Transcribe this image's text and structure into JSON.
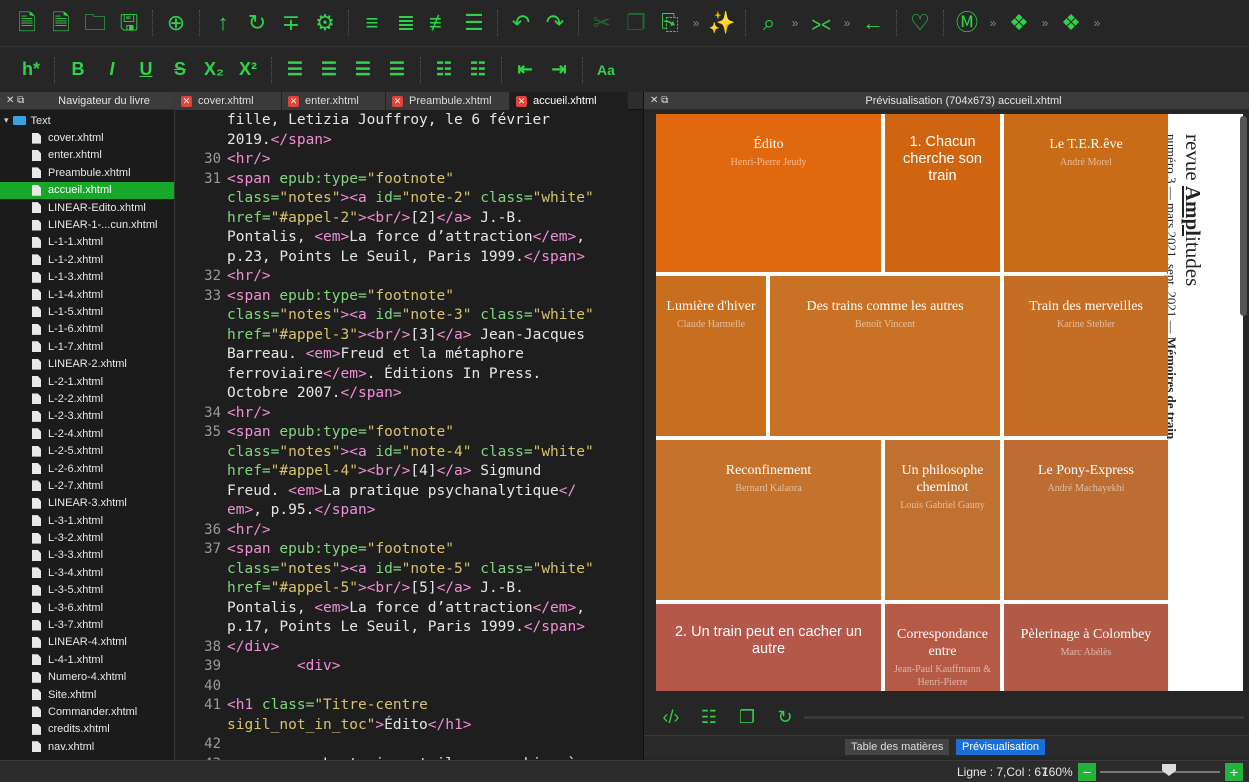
{
  "toolbar_icons": [
    "new-html-file-icon",
    "new-css-file-icon",
    "open-folder-icon",
    "save-icon",
    "add-existing-icon",
    "go-up-icon",
    "reload-icon",
    "text-direction-icon",
    "settings-icon",
    "tag-check-icon",
    "tag-add-icon",
    "tag-remove-icon",
    "tag-merge-icon",
    "undo-icon",
    "redo-icon",
    "cut-icon",
    "copy-icon",
    "paste-icon",
    "magic-wand-icon",
    "search-icon",
    "split-icon",
    "back-icon",
    "heart-icon",
    "metadata-icon",
    "plugin-icon",
    "plugin-2-icon"
  ],
  "format_toolbar": {
    "heading": "h*",
    "bold": "B",
    "italic": "I",
    "underline": "U",
    "strike": "S",
    "subscript": "X₂",
    "superscript": "X²",
    "case": "Aa"
  },
  "book_browser": {
    "title": "Navigateur du livre",
    "folder": "Text",
    "files": [
      "cover.xhtml",
      "enter.xhtml",
      "Preambule.xhtml",
      "accueil.xhtml",
      "LINEAR-Edito.xhtml",
      "LINEAR-1-...cun.xhtml",
      "L-1-1.xhtml",
      "L-1-2.xhtml",
      "L-1-3.xhtml",
      "L-1-4.xhtml",
      "L-1-5.xhtml",
      "L-1-6.xhtml",
      "L-1-7.xhtml",
      "LINEAR-2.xhtml",
      "L-2-1.xhtml",
      "L-2-2.xhtml",
      "L-2-3.xhtml",
      "L-2-4.xhtml",
      "L-2-5.xhtml",
      "L-2-6.xhtml",
      "L-2-7.xhtml",
      "LINEAR-3.xhtml",
      "L-3-1.xhtml",
      "L-3-2.xhtml",
      "L-3-3.xhtml",
      "L-3-4.xhtml",
      "L-3-5.xhtml",
      "L-3-6.xhtml",
      "L-3-7.xhtml",
      "LINEAR-4.xhtml",
      "L-4-1.xhtml",
      "Numero-4.xhtml",
      "Site.xhtml",
      "Commander.xhtml",
      "credits.xhtml",
      "nav.xhtml"
    ],
    "selected": "accueil.xhtml"
  },
  "tabs": [
    "cover.xhtml",
    "enter.xhtml",
    "Preambule.xhtml",
    "accueil.xhtml"
  ],
  "active_tab": "accueil.xhtml",
  "code_lines": [
    {
      "n": "",
      "parts": [
        [
          "tx",
          "fille, Letizia Jouffroy, le 6 février"
        ]
      ]
    },
    {
      "n": "",
      "parts": [
        [
          "tx",
          "2019."
        ],
        [
          "tg",
          "</span>"
        ]
      ]
    },
    {
      "n": "30",
      "parts": [
        [
          "tg",
          "<hr/>"
        ]
      ]
    },
    {
      "n": "31",
      "parts": [
        [
          "tg",
          "<span "
        ],
        [
          "at",
          "epub:type="
        ],
        [
          "st",
          "\"footnote\""
        ]
      ]
    },
    {
      "n": "",
      "parts": [
        [
          "at",
          "class="
        ],
        [
          "st",
          "\"notes\""
        ],
        [
          "tg",
          "><a "
        ],
        [
          "at",
          "id="
        ],
        [
          "st",
          "\"note-2\" "
        ],
        [
          "at",
          "class="
        ],
        [
          "st",
          "\"white\""
        ]
      ]
    },
    {
      "n": "",
      "parts": [
        [
          "at",
          "href="
        ],
        [
          "st",
          "\"#appel-2\""
        ],
        [
          "tg",
          "><br/>"
        ],
        [
          "tx",
          "[2]"
        ],
        [
          "tg",
          "</a>"
        ],
        [
          "tx",
          " J.-B."
        ]
      ]
    },
    {
      "n": "",
      "parts": [
        [
          "tx",
          "Pontalis, "
        ],
        [
          "tg",
          "<em>"
        ],
        [
          "tx",
          "La force d’attraction"
        ],
        [
          "tg",
          "</em>"
        ],
        [
          "tx",
          ","
        ]
      ]
    },
    {
      "n": "",
      "parts": [
        [
          "tx",
          "p.23, Points Le Seuil, Paris 1999."
        ],
        [
          "tg",
          "</span>"
        ]
      ]
    },
    {
      "n": "32",
      "parts": [
        [
          "tg",
          "<hr/>"
        ]
      ]
    },
    {
      "n": "33",
      "parts": [
        [
          "tg",
          "<span "
        ],
        [
          "at",
          "epub:type="
        ],
        [
          "st",
          "\"footnote\""
        ]
      ]
    },
    {
      "n": "",
      "parts": [
        [
          "at",
          "class="
        ],
        [
          "st",
          "\"notes\""
        ],
        [
          "tg",
          "><a "
        ],
        [
          "at",
          "id="
        ],
        [
          "st",
          "\"note-3\" "
        ],
        [
          "at",
          "class="
        ],
        [
          "st",
          "\"white\""
        ]
      ]
    },
    {
      "n": "",
      "parts": [
        [
          "at",
          "href="
        ],
        [
          "st",
          "\"#appel-3\""
        ],
        [
          "tg",
          "><br/>"
        ],
        [
          "tx",
          "[3]"
        ],
        [
          "tg",
          "</a>"
        ],
        [
          "tx",
          " Jean-Jacques"
        ]
      ]
    },
    {
      "n": "",
      "parts": [
        [
          "tx",
          "Barreau. "
        ],
        [
          "tg",
          "<em>"
        ],
        [
          "tx",
          "Freud et la métaphore"
        ]
      ]
    },
    {
      "n": "",
      "parts": [
        [
          "tx",
          "ferroviaire"
        ],
        [
          "tg",
          "</em>"
        ],
        [
          "tx",
          ". Éditions In Press."
        ]
      ]
    },
    {
      "n": "",
      "parts": [
        [
          "tx",
          "Octobre 2007."
        ],
        [
          "tg",
          "</span>"
        ]
      ]
    },
    {
      "n": "34",
      "parts": [
        [
          "tg",
          "<hr/>"
        ]
      ]
    },
    {
      "n": "35",
      "parts": [
        [
          "tg",
          "<span "
        ],
        [
          "at",
          "epub:type="
        ],
        [
          "st",
          "\"footnote\""
        ]
      ]
    },
    {
      "n": "",
      "parts": [
        [
          "at",
          "class="
        ],
        [
          "st",
          "\"notes\""
        ],
        [
          "tg",
          "><a "
        ],
        [
          "at",
          "id="
        ],
        [
          "st",
          "\"note-4\" "
        ],
        [
          "at",
          "class="
        ],
        [
          "st",
          "\"white\""
        ]
      ]
    },
    {
      "n": "",
      "parts": [
        [
          "at",
          "href="
        ],
        [
          "st",
          "\"#appel-4\""
        ],
        [
          "tg",
          "><br/>"
        ],
        [
          "tx",
          "[4]"
        ],
        [
          "tg",
          "</a>"
        ],
        [
          "tx",
          " Sigmund"
        ]
      ]
    },
    {
      "n": "",
      "parts": [
        [
          "tx",
          "Freud. "
        ],
        [
          "tg",
          "<em>"
        ],
        [
          "tx",
          "La pratique psychanalytique"
        ],
        [
          "tg",
          "</"
        ]
      ]
    },
    {
      "n": "",
      "parts": [
        [
          "tg",
          "em>"
        ],
        [
          "tx",
          ", p.95."
        ],
        [
          "tg",
          "</span>"
        ]
      ]
    },
    {
      "n": "36",
      "parts": [
        [
          "tg",
          "<hr/>"
        ]
      ]
    },
    {
      "n": "37",
      "parts": [
        [
          "tg",
          "<span "
        ],
        [
          "at",
          "epub:type="
        ],
        [
          "st",
          "\"footnote\""
        ]
      ]
    },
    {
      "n": "",
      "parts": [
        [
          "at",
          "class="
        ],
        [
          "st",
          "\"notes\""
        ],
        [
          "tg",
          "><a "
        ],
        [
          "at",
          "id="
        ],
        [
          "st",
          "\"note-5\" "
        ],
        [
          "at",
          "class="
        ],
        [
          "st",
          "\"white\""
        ]
      ]
    },
    {
      "n": "",
      "parts": [
        [
          "at",
          "href="
        ],
        [
          "st",
          "\"#appel-5\""
        ],
        [
          "tg",
          "><br/>"
        ],
        [
          "tx",
          "[5]"
        ],
        [
          "tg",
          "</a>"
        ],
        [
          "tx",
          " J.-B."
        ]
      ]
    },
    {
      "n": "",
      "parts": [
        [
          "tx",
          "Pontalis, "
        ],
        [
          "tg",
          "<em>"
        ],
        [
          "tx",
          "La force d’attraction"
        ],
        [
          "tg",
          "</em>"
        ],
        [
          "tx",
          ","
        ]
      ]
    },
    {
      "n": "",
      "parts": [
        [
          "tx",
          "p.17, Points Le Seuil, Paris 1999."
        ],
        [
          "tg",
          "</span>"
        ]
      ]
    },
    {
      "n": "38",
      "parts": [
        [
          "tg",
          "</div>"
        ]
      ]
    },
    {
      "n": "39",
      "parts": [
        [
          "tx",
          "        "
        ],
        [
          "tg",
          "<div>"
        ]
      ]
    },
    {
      "n": "40",
      "parts": []
    },
    {
      "n": "41",
      "parts": [
        [
          "tg",
          "<h1 "
        ],
        [
          "at",
          "class="
        ],
        [
          "st",
          "\"Titre-centre"
        ]
      ]
    },
    {
      "n": "",
      "parts": [
        [
          "st",
          "sigil_not_in_toc\""
        ],
        [
          "tg",
          ">"
        ],
        [
          "tx",
          "Édito"
        ],
        [
          "tg",
          "</h1>"
        ]
      ]
    },
    {
      "n": "42",
      "parts": []
    },
    {
      "n": "43",
      "parts": [
        [
          "tx",
          "        "
        ],
        [
          "tg",
          "<p>"
        ],
        [
          "tx",
          "Le train est-il une machine à"
        ]
      ]
    }
  ],
  "preview": {
    "title": "Prévisualisation (704x673) accueil.xhtml",
    "tiles": [
      {
        "title": "Édito",
        "author": "Henri-Pierre Jeudy",
        "color": "#e0690f",
        "sans": false
      },
      {
        "title": "1. Chacun cherche son train",
        "author": "",
        "color": "#cf6510",
        "sans": true
      },
      {
        "title": "Le T.E.R.êve",
        "author": "André Morel",
        "color": "#c96c18",
        "sans": false
      },
      {
        "title": "Lumière d'hiver",
        "author": "Claude Harmelle",
        "color": "#c86e1f",
        "sans": false
      },
      {
        "title": "Des trains comme les autres",
        "author": "Benoît Vincent",
        "color": "#c97225",
        "sans": false
      },
      {
        "title": "Train des merveilles",
        "author": "Karine Stebler",
        "color": "#c46d24",
        "sans": false
      },
      {
        "title": "Reconfinement",
        "author": "Bernard Kalaora",
        "color": "#c5722c",
        "sans": false
      },
      {
        "title": "Un philosophe cheminot",
        "author": "Louis Gabriel Gauny",
        "color": "#c1712f",
        "sans": false
      },
      {
        "title": "Le Pony-Express",
        "author": "André Machayekhi",
        "color": "#bd6c34",
        "sans": false
      },
      {
        "title": "2. Un train peut en cacher un autre",
        "author": "",
        "color": "#b5574a",
        "sans": true
      },
      {
        "title": "Correspondance entre",
        "author": "Jean-Paul Kauffmann & Henri-Pierre",
        "color": "#b45a46",
        "sans": false
      },
      {
        "title": "Pèlerinage à Colombey",
        "author": "Marc Abélès",
        "color": "#b25a48",
        "sans": false
      }
    ],
    "vertical_title": {
      "prefix": "revue ",
      "brand_a": "Ampl",
      "brand_b": "itudes",
      "issue": "numéro 3 — mars 2021, sept. 2021 — ",
      "subtitle": "Mémoires de train"
    },
    "tool_icons": [
      "code-view-icon",
      "select-all-icon",
      "copy-icon",
      "refresh-icon"
    ],
    "tabs": [
      "Table des matières",
      "Prévisualisation"
    ],
    "active_tab": "Prévisualisation"
  },
  "status": {
    "position": "Ligne : 7,Col : 67",
    "zoom": "160%",
    "zoom_out": "−",
    "zoom_in": "+"
  }
}
